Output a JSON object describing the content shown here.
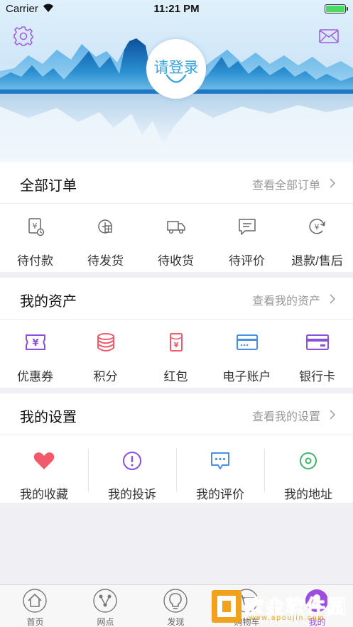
{
  "status_bar": {
    "carrier": "Carrier",
    "time": "11:21 PM",
    "battery_level": 1.0
  },
  "header": {
    "login_label": "请登录",
    "settings_icon": "gear-icon",
    "message_icon": "mail-icon"
  },
  "orders": {
    "title": "全部订单",
    "link": "查看全部订单",
    "items": [
      {
        "label": "待付款",
        "icon": "payment-pending-icon"
      },
      {
        "label": "待发货",
        "icon": "to-ship-icon"
      },
      {
        "label": "待收货",
        "icon": "truck-icon"
      },
      {
        "label": "待评价",
        "icon": "review-icon"
      },
      {
        "label": "退款/售后",
        "icon": "refund-icon"
      }
    ]
  },
  "assets": {
    "title": "我的资产",
    "link": "查看我的资产",
    "items": [
      {
        "label": "优惠券",
        "icon": "coupon-icon",
        "color": "#8b4fe0"
      },
      {
        "label": "积分",
        "icon": "points-stack-icon",
        "color": "#f05a6a"
      },
      {
        "label": "红包",
        "icon": "red-packet-icon",
        "color": "#f05a6a"
      },
      {
        "label": "电子账户",
        "icon": "e-account-card-icon",
        "color": "#4a8ee8"
      },
      {
        "label": "银行卡",
        "icon": "bank-card-icon",
        "color": "#8b4fe0"
      }
    ]
  },
  "settings": {
    "title": "我的设置",
    "link": "查看我的设置",
    "items": [
      {
        "label": "我的收藏",
        "icon": "heart-icon",
        "color": "#f05a6a"
      },
      {
        "label": "我的投诉",
        "icon": "exclamation-icon",
        "color": "#8b4fe0"
      },
      {
        "label": "我的评价",
        "icon": "comment-icon",
        "color": "#4a8ee8"
      },
      {
        "label": "我的地址",
        "icon": "location-pin-icon",
        "color": "#3fb36a"
      }
    ]
  },
  "tabbar": {
    "tabs": [
      {
        "label": "首页",
        "icon": "home-icon"
      },
      {
        "label": "网点",
        "icon": "network-icon"
      },
      {
        "label": "发现",
        "icon": "lightbulb-icon"
      },
      {
        "label": "购物车",
        "icon": "cart-icon"
      },
      {
        "label": "我的",
        "icon": "profile-icon"
      }
    ],
    "active_index": 4
  },
  "watermark": {
    "text": "欧金软件园",
    "url": "www.apoujin.com"
  },
  "colors": {
    "accent": "#9b4de0",
    "login_blue": "#3aa4dc",
    "muted": "#999999"
  }
}
